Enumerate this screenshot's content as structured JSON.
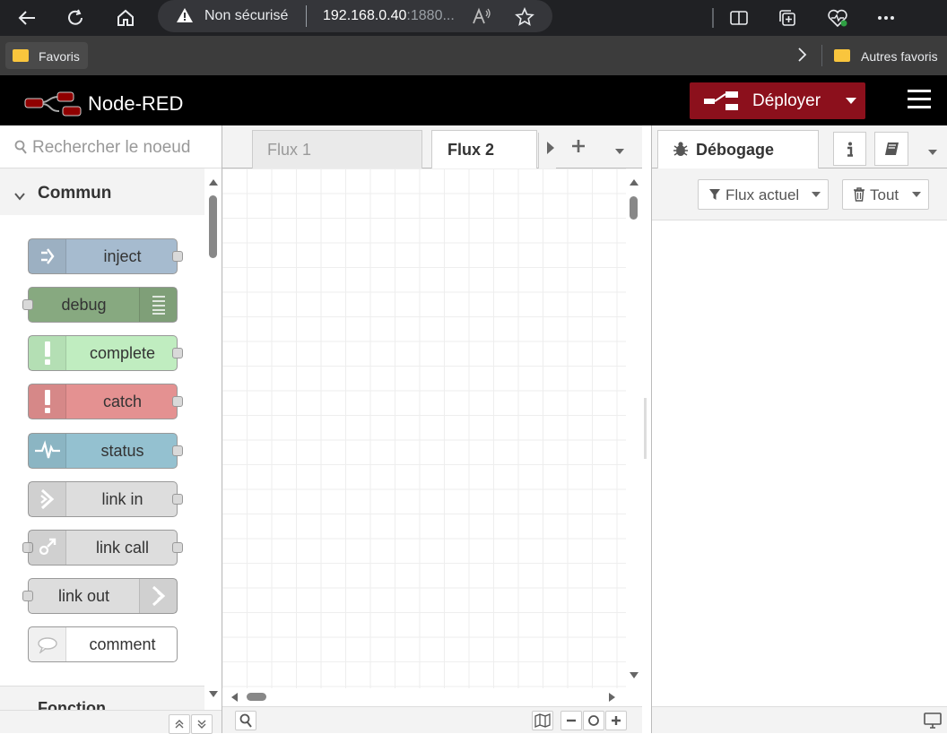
{
  "browser": {
    "security_label": "Non sécurisé",
    "url_host": "192.168.0.40",
    "url_port": ":1880...",
    "favorites_label": "Favoris",
    "other_favorites_label": "Autres favoris"
  },
  "header": {
    "app_title": "Node-RED",
    "deploy_label": "Déployer"
  },
  "palette": {
    "search_placeholder": "Rechercher le noeud",
    "category": "Commun",
    "next_category": "Fonction",
    "nodes": [
      {
        "label": "inject",
        "color": "#a6bbcf"
      },
      {
        "label": "debug",
        "color": "#87a980"
      },
      {
        "label": "complete",
        "color": "#c0edc0"
      },
      {
        "label": "catch",
        "color": "#e49191"
      },
      {
        "label": "status",
        "color": "#94c1d0"
      },
      {
        "label": "link in",
        "color": "#dddddd"
      },
      {
        "label": "link call",
        "color": "#dddddd"
      },
      {
        "label": "link out",
        "color": "#dddddd"
      },
      {
        "label": "comment",
        "color": "#ffffff"
      }
    ]
  },
  "workspace": {
    "tabs": [
      "Flux 1",
      "Flux 2"
    ],
    "active_tab": "Flux 2"
  },
  "sidebar": {
    "active_tab": "Débogage",
    "filter_label": "Flux actuel",
    "clear_label": "Tout"
  },
  "colors": {
    "deploy": "#8c101c",
    "header": "#000000"
  }
}
